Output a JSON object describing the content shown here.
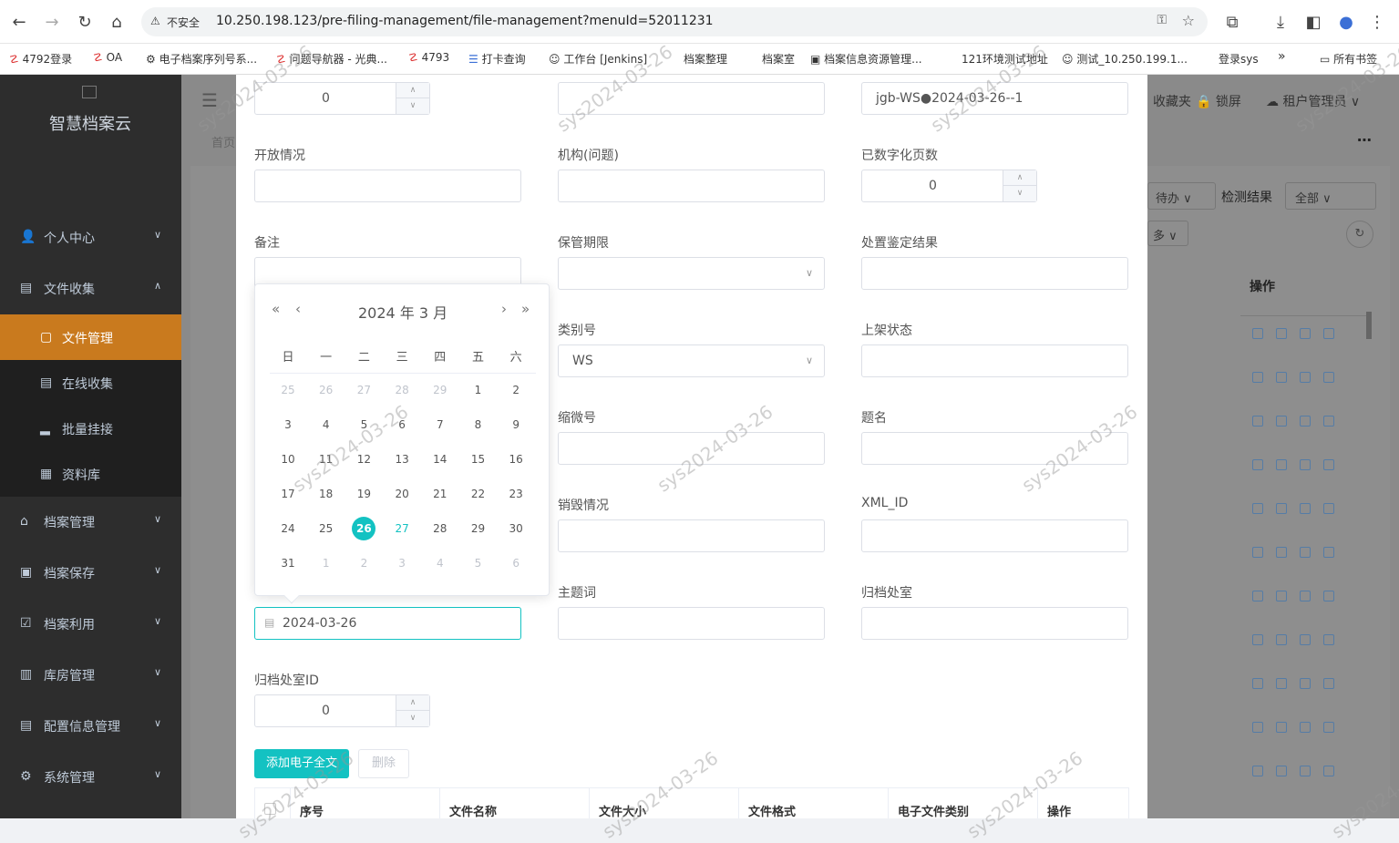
{
  "browser": {
    "security": "不安全",
    "url": "10.250.198.123/pre-filing-management/file-management?menuId=52011231",
    "bookmarks": [
      "4792登录",
      "OA",
      "电子档案序列号系...",
      "问题导航器 - 光典...",
      "4793",
      "打卡查询",
      "工作台 [Jenkins]",
      "档案整理",
      "档案室",
      "档案信息资源管理...",
      "121环境测试地址",
      "测试_10.250.199.1...",
      "登录sys",
      "所有书签"
    ]
  },
  "sidebar": {
    "logo": "智慧档案云",
    "items": [
      {
        "label": "个人中心"
      },
      {
        "label": "文件收集"
      },
      {
        "label": "档案管理"
      },
      {
        "label": "档案保存"
      },
      {
        "label": "档案利用"
      },
      {
        "label": "库房管理"
      },
      {
        "label": "配置信息管理"
      },
      {
        "label": "系统管理"
      }
    ],
    "sub_items": [
      "文件管理",
      "在线收集",
      "批量挂接",
      "资料库"
    ]
  },
  "background": {
    "header": [
      "收藏夹",
      "锁屏",
      "租户管理员"
    ],
    "breadcrumb": "首页",
    "filters": {
      "status": "待办",
      "detect_label": "检测结果",
      "detect_value": "全部",
      "more": "多"
    },
    "table_header": "操作"
  },
  "form": {
    "row0": {
      "num1": "0",
      "text3": "jgb-WS●2024-03-26--1"
    },
    "labels": {
      "kaifang": "开放情况",
      "jigou": "机构(问题)",
      "shuzihua": "已数字化页数",
      "beizhu": "备注",
      "baoguan": "保管期限",
      "chuzhi": "处置鉴定结果",
      "leibie": "类别号",
      "shangjia": "上架状态",
      "suowei": "缩微号",
      "timing": "题名",
      "xiaohui": "销毁情况",
      "xmlid": "XML_ID",
      "zhuti": "主题词",
      "guidang": "归档处室",
      "guidangid": "归档处室ID"
    },
    "shuzihua_value": "0",
    "leibie_value": "WS",
    "date_value": "2024-03-26",
    "guidangid_value": "0",
    "add_button": "添加电子全文",
    "delete_button": "删除",
    "table_headers": [
      "序号",
      "文件名称",
      "文件大小",
      "文件格式",
      "电子文件类别",
      "操作"
    ]
  },
  "calendar": {
    "title": "2024 年  3 月",
    "weekdays": [
      "日",
      "一",
      "二",
      "三",
      "四",
      "五",
      "六"
    ],
    "rows": [
      [
        "25",
        "26",
        "27",
        "28",
        "29",
        "1",
        "2"
      ],
      [
        "3",
        "4",
        "5",
        "6",
        "7",
        "8",
        "9"
      ],
      [
        "10",
        "11",
        "12",
        "13",
        "14",
        "15",
        "16"
      ],
      [
        "17",
        "18",
        "19",
        "20",
        "21",
        "22",
        "23"
      ],
      [
        "24",
        "25",
        "26",
        "27",
        "28",
        "29",
        "30"
      ],
      [
        "31",
        "1",
        "2",
        "3",
        "4",
        "5",
        "6"
      ]
    ]
  },
  "watermark": "sys2024-03-26"
}
